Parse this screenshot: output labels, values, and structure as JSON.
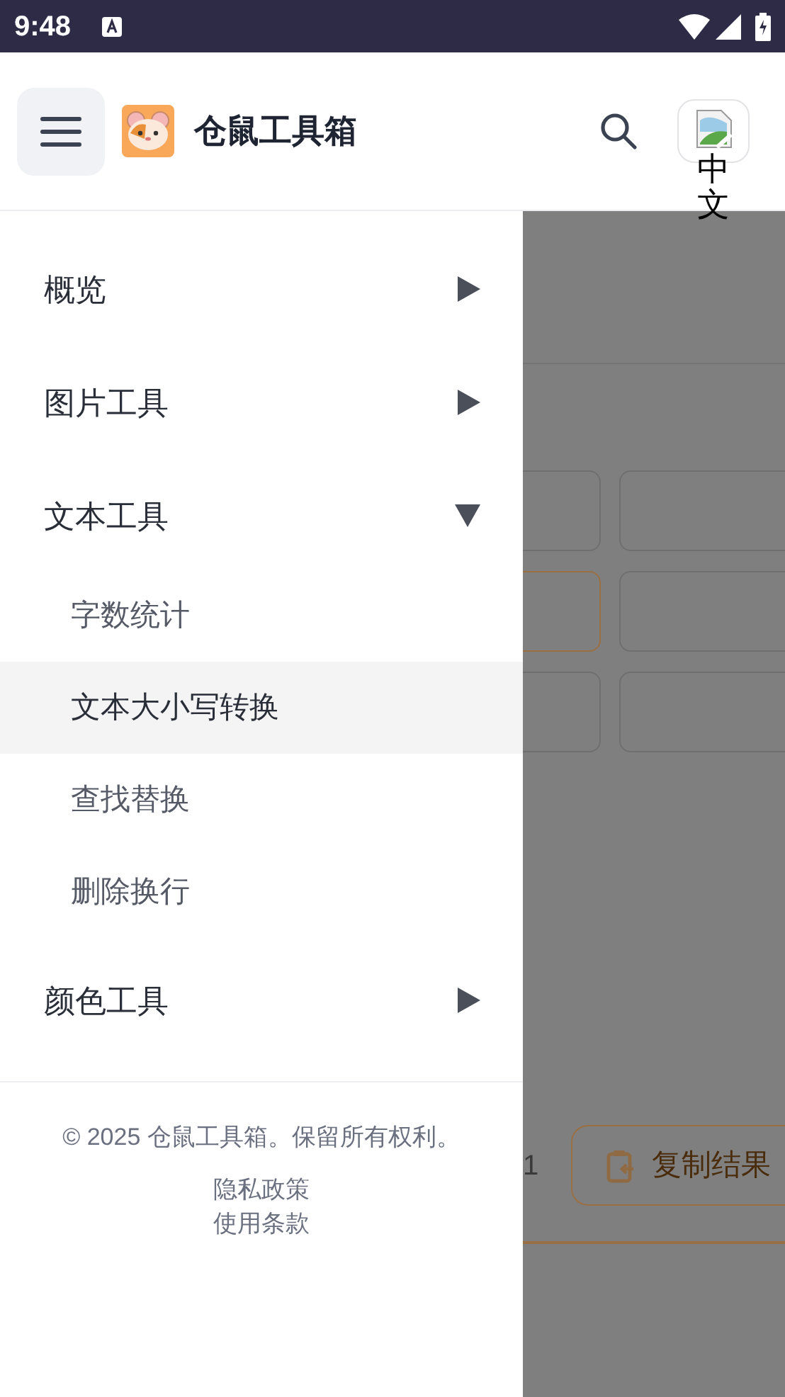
{
  "status_bar": {
    "time": "9:48"
  },
  "header": {
    "title": "仓鼠工具箱",
    "language_button": {
      "alt": "中文"
    }
  },
  "drawer": {
    "items": [
      {
        "label": "概览",
        "expanded": false
      },
      {
        "label": "图片工具",
        "expanded": false
      },
      {
        "label": "文本工具",
        "expanded": true,
        "children": [
          {
            "label": "字数统计",
            "selected": false
          },
          {
            "label": "文本大小写转换",
            "selected": true
          },
          {
            "label": "查找替换",
            "selected": false
          },
          {
            "label": "删除换行",
            "selected": false
          }
        ]
      },
      {
        "label": "颜色工具",
        "expanded": false
      }
    ],
    "footer": {
      "copyright": "© 2025 仓鼠工具箱。保留所有权利。",
      "links": [
        "隐私政策",
        "使用条款"
      ]
    }
  },
  "background_page": {
    "count": "1",
    "copy_button": "复制结果"
  }
}
